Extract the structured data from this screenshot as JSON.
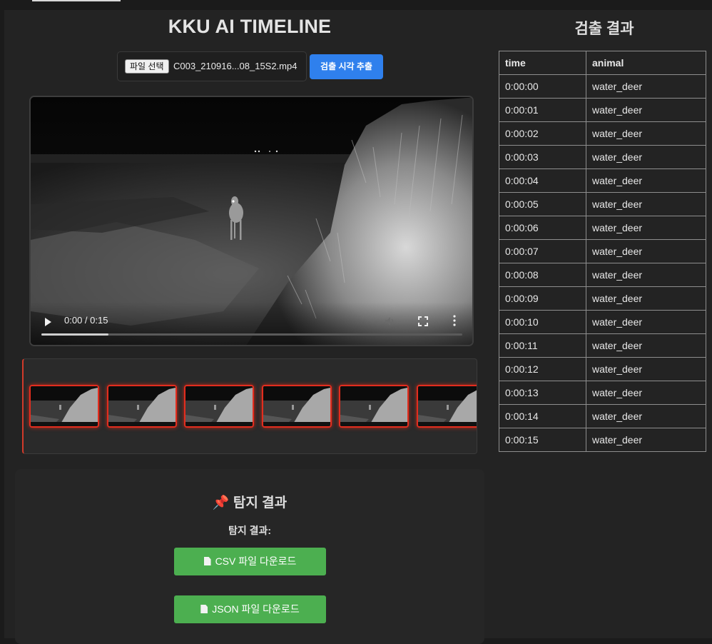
{
  "app": {
    "title": "KKU AI TIMELINE"
  },
  "file_input": {
    "button_label": "파일 선택",
    "file_name": "C003_210916...08_15S2.mp4"
  },
  "extract_button": {
    "label": "검출 시각 추출",
    "color": "#2f80ed"
  },
  "video": {
    "time_display": "0:00 / 0:15",
    "progress_fraction": 0.16
  },
  "thumbnails": {
    "count_visible": 6,
    "highlight_color": "#e32d1e"
  },
  "result_panel": {
    "title": "📌 탐지 결과",
    "subtitle": "탐지 결과:",
    "csv_button": "CSV 파일 다운로드",
    "json_button": "JSON 파일 다운로드",
    "button_color": "#4caf50"
  },
  "detection": {
    "title": "검출 결과",
    "columns": [
      "time",
      "animal"
    ],
    "rows": [
      [
        "0:00:00",
        "water_deer"
      ],
      [
        "0:00:01",
        "water_deer"
      ],
      [
        "0:00:02",
        "water_deer"
      ],
      [
        "0:00:03",
        "water_deer"
      ],
      [
        "0:00:04",
        "water_deer"
      ],
      [
        "0:00:05",
        "water_deer"
      ],
      [
        "0:00:06",
        "water_deer"
      ],
      [
        "0:00:07",
        "water_deer"
      ],
      [
        "0:00:08",
        "water_deer"
      ],
      [
        "0:00:09",
        "water_deer"
      ],
      [
        "0:00:10",
        "water_deer"
      ],
      [
        "0:00:11",
        "water_deer"
      ],
      [
        "0:00:12",
        "water_deer"
      ],
      [
        "0:00:13",
        "water_deer"
      ],
      [
        "0:00:14",
        "water_deer"
      ],
      [
        "0:00:15",
        "water_deer"
      ]
    ]
  }
}
